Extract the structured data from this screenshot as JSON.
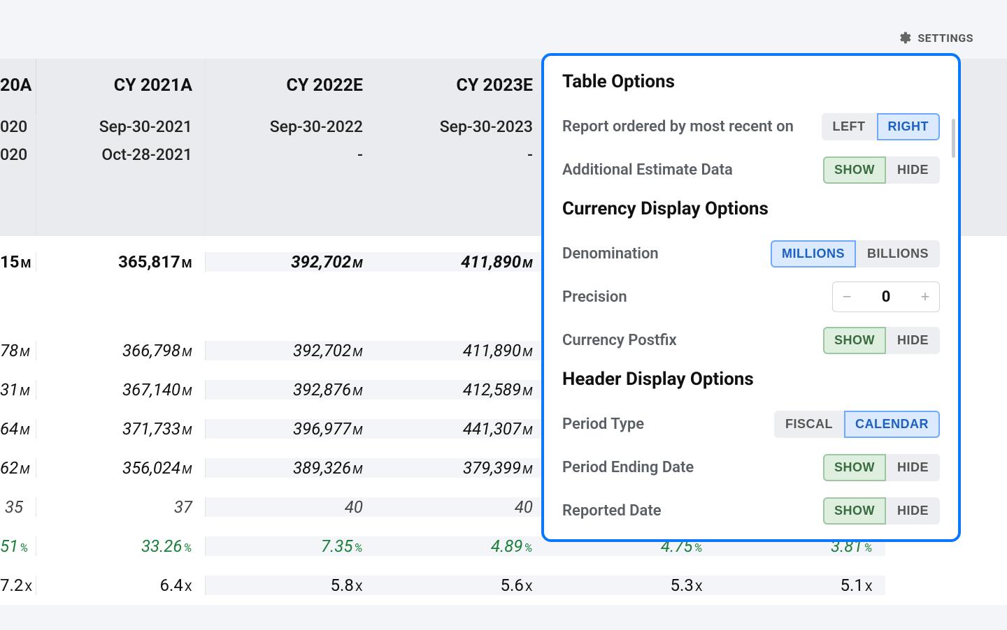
{
  "settings_label": "SETTINGS",
  "columns": [
    {
      "year": "20A",
      "date": "020",
      "reported": "020",
      "year_full": true
    },
    {
      "year": "CY 2021A",
      "date": "Sep-30-2021",
      "reported": "Oct-28-2021"
    },
    {
      "year": "CY 2022E",
      "date": "Sep-30-2022",
      "reported": "-"
    },
    {
      "year": "CY 2023E",
      "date": "Sep-30-2023",
      "reported": "-"
    },
    {
      "year": "",
      "date": "",
      "reported": ""
    },
    {
      "year": "",
      "date": "",
      "reported": ""
    }
  ],
  "rows": {
    "headline": {
      "vals": [
        "15",
        "365,817",
        "392,702",
        "411,890",
        "",
        ""
      ],
      "unit": "M",
      "bold": true
    },
    "r1": {
      "vals": [
        "78",
        "366,798",
        "392,702",
        "411,890",
        "",
        ""
      ],
      "unit": "M",
      "italic": true
    },
    "r2": {
      "vals": [
        "31",
        "367,140",
        "392,876",
        "412,589",
        "",
        ""
      ],
      "unit": "M",
      "italic": true
    },
    "r3": {
      "vals": [
        "64",
        "371,733",
        "396,977",
        "441,307",
        "",
        ""
      ],
      "unit": "M",
      "italic": true
    },
    "r4": {
      "vals": [
        "62",
        "356,024",
        "389,326",
        "379,399",
        "",
        ""
      ],
      "unit": "M",
      "italic": true
    },
    "r5": {
      "vals": [
        "35",
        "37",
        "40",
        "40",
        "",
        ""
      ],
      "unit": "",
      "italic": true
    },
    "r6": {
      "vals": [
        "51",
        "33.26",
        "7.35",
        "4.89",
        "4.75",
        "3.81"
      ],
      "unit": "%",
      "italic": true,
      "green": true
    },
    "r7": {
      "vals": [
        "7.2",
        "6.4",
        "5.8",
        "5.6",
        "5.3",
        "5.1"
      ],
      "unit": "X"
    }
  },
  "panel": {
    "section_table": "Table Options",
    "opt_order": "Report ordered by most recent on",
    "left": "LEFT",
    "right": "RIGHT",
    "opt_est": "Additional Estimate Data",
    "show": "SHOW",
    "hide": "HIDE",
    "section_currency": "Currency Display Options",
    "opt_denom": "Denomination",
    "millions": "MILLIONS",
    "billions": "BILLIONS",
    "opt_precision": "Precision",
    "precision_value": "0",
    "opt_postfix": "Currency Postfix",
    "section_header": "Header Display Options",
    "opt_period_type": "Period Type",
    "fiscal": "FISCAL",
    "calendar": "CALENDAR",
    "opt_period_end": "Period Ending Date",
    "opt_reported": "Reported Date"
  }
}
